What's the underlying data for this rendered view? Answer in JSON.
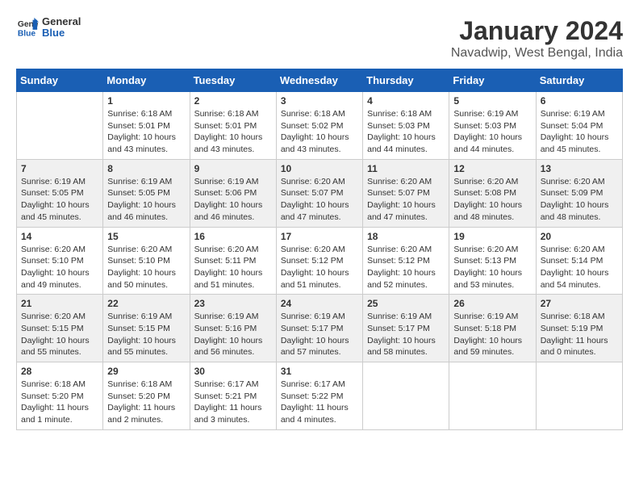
{
  "header": {
    "logo_general": "General",
    "logo_blue": "Blue",
    "month_title": "January 2024",
    "location": "Navadwip, West Bengal, India"
  },
  "days_of_week": [
    "Sunday",
    "Monday",
    "Tuesday",
    "Wednesday",
    "Thursday",
    "Friday",
    "Saturday"
  ],
  "weeks": [
    [
      {
        "day": "",
        "info": ""
      },
      {
        "day": "1",
        "info": "Sunrise: 6:18 AM\nSunset: 5:01 PM\nDaylight: 10 hours\nand 43 minutes."
      },
      {
        "day": "2",
        "info": "Sunrise: 6:18 AM\nSunset: 5:01 PM\nDaylight: 10 hours\nand 43 minutes."
      },
      {
        "day": "3",
        "info": "Sunrise: 6:18 AM\nSunset: 5:02 PM\nDaylight: 10 hours\nand 43 minutes."
      },
      {
        "day": "4",
        "info": "Sunrise: 6:18 AM\nSunset: 5:03 PM\nDaylight: 10 hours\nand 44 minutes."
      },
      {
        "day": "5",
        "info": "Sunrise: 6:19 AM\nSunset: 5:03 PM\nDaylight: 10 hours\nand 44 minutes."
      },
      {
        "day": "6",
        "info": "Sunrise: 6:19 AM\nSunset: 5:04 PM\nDaylight: 10 hours\nand 45 minutes."
      }
    ],
    [
      {
        "day": "7",
        "info": "Sunrise: 6:19 AM\nSunset: 5:05 PM\nDaylight: 10 hours\nand 45 minutes."
      },
      {
        "day": "8",
        "info": "Sunrise: 6:19 AM\nSunset: 5:05 PM\nDaylight: 10 hours\nand 46 minutes."
      },
      {
        "day": "9",
        "info": "Sunrise: 6:19 AM\nSunset: 5:06 PM\nDaylight: 10 hours\nand 46 minutes."
      },
      {
        "day": "10",
        "info": "Sunrise: 6:20 AM\nSunset: 5:07 PM\nDaylight: 10 hours\nand 47 minutes."
      },
      {
        "day": "11",
        "info": "Sunrise: 6:20 AM\nSunset: 5:07 PM\nDaylight: 10 hours\nand 47 minutes."
      },
      {
        "day": "12",
        "info": "Sunrise: 6:20 AM\nSunset: 5:08 PM\nDaylight: 10 hours\nand 48 minutes."
      },
      {
        "day": "13",
        "info": "Sunrise: 6:20 AM\nSunset: 5:09 PM\nDaylight: 10 hours\nand 48 minutes."
      }
    ],
    [
      {
        "day": "14",
        "info": "Sunrise: 6:20 AM\nSunset: 5:10 PM\nDaylight: 10 hours\nand 49 minutes."
      },
      {
        "day": "15",
        "info": "Sunrise: 6:20 AM\nSunset: 5:10 PM\nDaylight: 10 hours\nand 50 minutes."
      },
      {
        "day": "16",
        "info": "Sunrise: 6:20 AM\nSunset: 5:11 PM\nDaylight: 10 hours\nand 51 minutes."
      },
      {
        "day": "17",
        "info": "Sunrise: 6:20 AM\nSunset: 5:12 PM\nDaylight: 10 hours\nand 51 minutes."
      },
      {
        "day": "18",
        "info": "Sunrise: 6:20 AM\nSunset: 5:12 PM\nDaylight: 10 hours\nand 52 minutes."
      },
      {
        "day": "19",
        "info": "Sunrise: 6:20 AM\nSunset: 5:13 PM\nDaylight: 10 hours\nand 53 minutes."
      },
      {
        "day": "20",
        "info": "Sunrise: 6:20 AM\nSunset: 5:14 PM\nDaylight: 10 hours\nand 54 minutes."
      }
    ],
    [
      {
        "day": "21",
        "info": "Sunrise: 6:20 AM\nSunset: 5:15 PM\nDaylight: 10 hours\nand 55 minutes."
      },
      {
        "day": "22",
        "info": "Sunrise: 6:19 AM\nSunset: 5:15 PM\nDaylight: 10 hours\nand 55 minutes."
      },
      {
        "day": "23",
        "info": "Sunrise: 6:19 AM\nSunset: 5:16 PM\nDaylight: 10 hours\nand 56 minutes."
      },
      {
        "day": "24",
        "info": "Sunrise: 6:19 AM\nSunset: 5:17 PM\nDaylight: 10 hours\nand 57 minutes."
      },
      {
        "day": "25",
        "info": "Sunrise: 6:19 AM\nSunset: 5:17 PM\nDaylight: 10 hours\nand 58 minutes."
      },
      {
        "day": "26",
        "info": "Sunrise: 6:19 AM\nSunset: 5:18 PM\nDaylight: 10 hours\nand 59 minutes."
      },
      {
        "day": "27",
        "info": "Sunrise: 6:18 AM\nSunset: 5:19 PM\nDaylight: 11 hours\nand 0 minutes."
      }
    ],
    [
      {
        "day": "28",
        "info": "Sunrise: 6:18 AM\nSunset: 5:20 PM\nDaylight: 11 hours\nand 1 minute."
      },
      {
        "day": "29",
        "info": "Sunrise: 6:18 AM\nSunset: 5:20 PM\nDaylight: 11 hours\nand 2 minutes."
      },
      {
        "day": "30",
        "info": "Sunrise: 6:17 AM\nSunset: 5:21 PM\nDaylight: 11 hours\nand 3 minutes."
      },
      {
        "day": "31",
        "info": "Sunrise: 6:17 AM\nSunset: 5:22 PM\nDaylight: 11 hours\nand 4 minutes."
      },
      {
        "day": "",
        "info": ""
      },
      {
        "day": "",
        "info": ""
      },
      {
        "day": "",
        "info": ""
      }
    ]
  ]
}
